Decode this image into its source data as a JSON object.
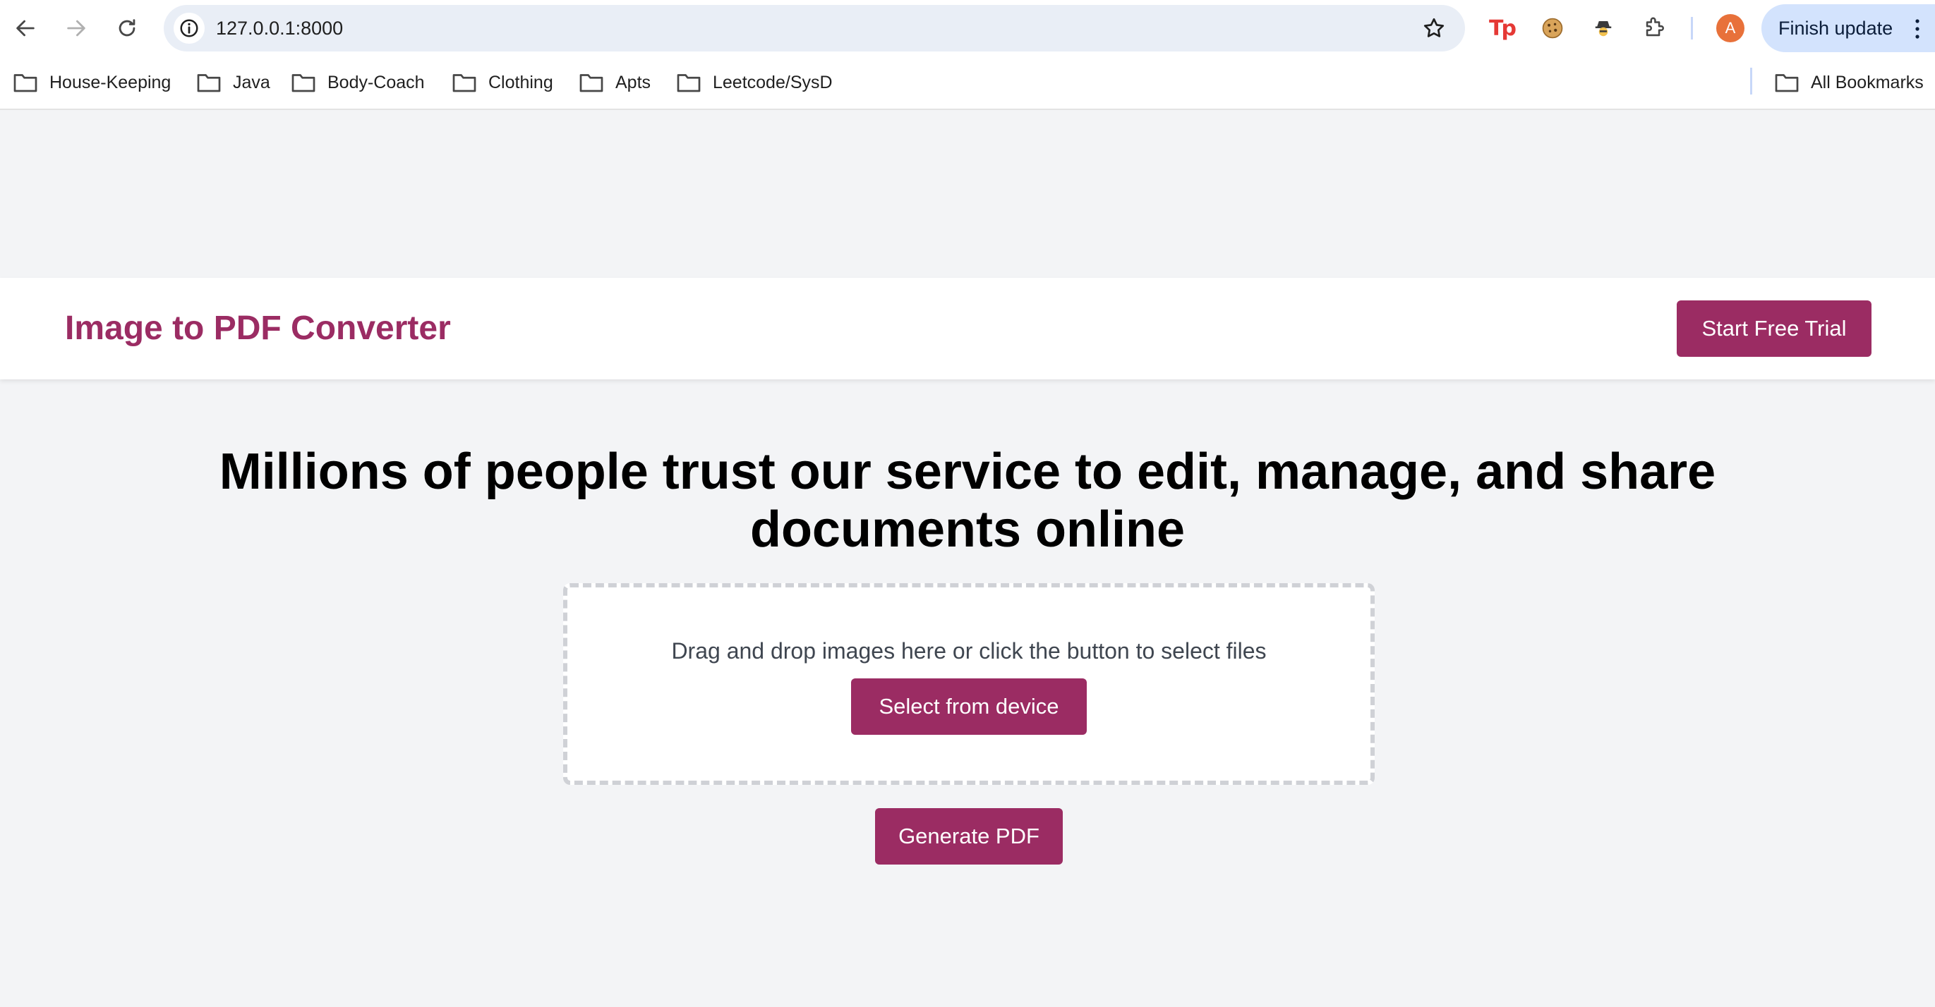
{
  "browser": {
    "url": "127.0.0.1:8000",
    "finish_update_label": "Finish update",
    "profile_initial": "A",
    "extension_tp_label": "Tp",
    "bookmarks": [
      {
        "label": "House-Keeping"
      },
      {
        "label": "Java"
      },
      {
        "label": "Body-Coach"
      },
      {
        "label": "Clothing"
      },
      {
        "label": "Apts"
      },
      {
        "label": "Leetcode/SysD"
      }
    ],
    "all_bookmarks_label": "All Bookmarks"
  },
  "app": {
    "brand": "Image to PDF Converter",
    "trial_button": "Start Free Trial",
    "headline": "Millions of people trust our service to edit, manage, and share documents online",
    "dropzone_text": "Drag and drop images here or click the button to select files",
    "select_button": "Select from device",
    "generate_button": "Generate PDF"
  },
  "colors": {
    "brand": "#9b2c63",
    "page_background": "#f3f4f6",
    "dropzone_border": "#cfd1d6"
  }
}
